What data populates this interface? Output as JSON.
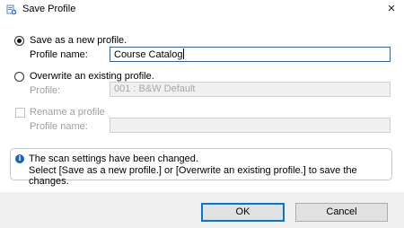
{
  "window": {
    "title": "Save Profile",
    "close_symbol": "×"
  },
  "save_new": {
    "option_label": "Save as a new profile.",
    "name_label": "Profile name:",
    "name_value": "Course Catalog",
    "checked": true
  },
  "overwrite": {
    "option_label": "Overwrite an existing profile.",
    "profile_label": "Profile:",
    "profile_value": "001 : B&W Default",
    "checked": false
  },
  "rename": {
    "checkbox_label": "Rename a profile",
    "name_label": "Profile name:",
    "name_value": ""
  },
  "info": {
    "line1": "The scan settings have been changed.",
    "line2": "Select [Save as a new profile.] or [Overwrite an existing profile.] to save the changes."
  },
  "buttons": {
    "ok": "OK",
    "cancel": "Cancel"
  },
  "colors": {
    "accent": "#0078d7",
    "info_icon": "#1565c0"
  }
}
